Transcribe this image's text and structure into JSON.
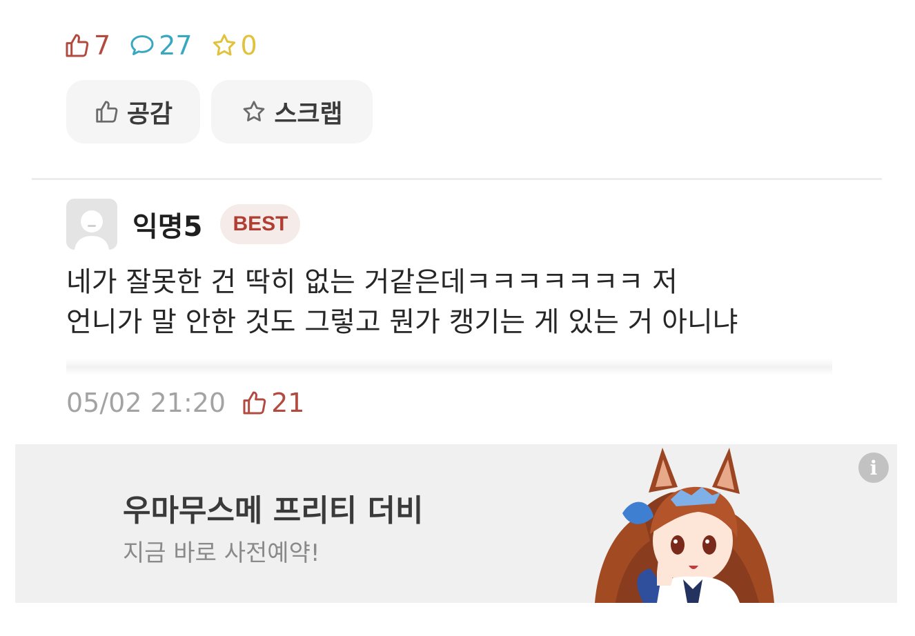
{
  "post_stats": {
    "likes": "7",
    "comments": "27",
    "scraps": "0"
  },
  "actions": {
    "like_label": "공감",
    "scrap_label": "스크랩"
  },
  "comment": {
    "author": "익명5",
    "badge": "BEST",
    "lines": [
      "네가 잘못한 건 딱히 없는 거같은데ㅋㅋㅋㅋㅋㅋㅋ 저",
      "언니가 말 안한 것도 그렇고 뭔가 캥기는 게 있는 거 아니냐"
    ],
    "timestamp": "05/02 21:20",
    "likes": "21"
  },
  "ad": {
    "title": "우마무스메 프리티 더비",
    "subtitle": "지금 바로 사전예약!",
    "info_icon": "i"
  },
  "colors": {
    "like": "#b24a3f",
    "comment": "#3aa7c0",
    "scrap": "#e0c23c",
    "badge_bg": "#f5ecea",
    "badge_text": "#b03e33"
  },
  "icons": [
    "thumbs-up-icon",
    "speech-bubble-icon",
    "star-icon",
    "avatar-placeholder-icon",
    "info-icon"
  ]
}
